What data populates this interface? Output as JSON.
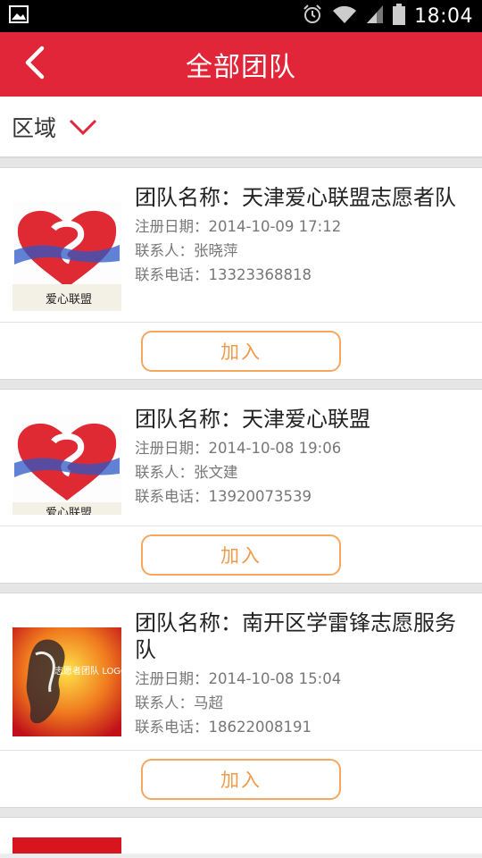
{
  "status_bar": {
    "time": "18:04",
    "icons": [
      "image-icon",
      "alarm-icon",
      "wifi-icon",
      "signal-icon",
      "battery-icon"
    ]
  },
  "header": {
    "title": "全部团队",
    "back_icon": "chevron-left-icon"
  },
  "filter": {
    "label": "区域",
    "icon": "chevron-down-icon"
  },
  "teams": [
    {
      "name": "团队名称：天津爱心联盟志愿者队",
      "date": "注册日期：2014-10-09 17:12",
      "contact": "联系人：张晓萍",
      "phone": "联系电话：13323368818",
      "join_label": "加入",
      "logo_caption": "爱心联盟"
    },
    {
      "name": "团队名称：天津爱心联盟",
      "date": "注册日期：2014-10-08 19:06",
      "contact": "联系人：张文建",
      "phone": "联系电话：13920073539",
      "join_label": "加入",
      "logo_caption": "爱心联盟"
    },
    {
      "name": "团队名称：南开区学雷锋志愿服务队",
      "date": "注册日期：2014-10-08 15:04",
      "contact": "联系人：马超",
      "phone": "联系电话：18622008191",
      "join_label": "加入",
      "logo_caption": "志愿者团队 LOGO"
    }
  ],
  "colors": {
    "primary": "#e02638",
    "join_border": "#f5a760",
    "join_text": "#f09a4a"
  }
}
